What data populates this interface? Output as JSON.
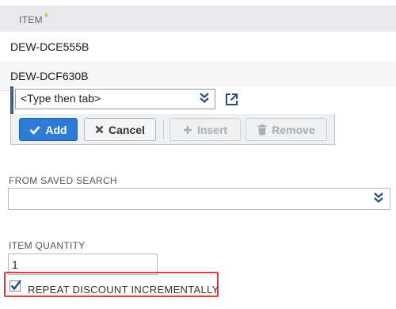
{
  "grid": {
    "header": {
      "label": "ITEM",
      "required_mark": "*"
    },
    "rows": [
      {
        "item": "DEW-DCE555B"
      },
      {
        "item": "DEW-DCF630B"
      }
    ],
    "edit_row": {
      "placeholder_value": "<Type then tab>"
    }
  },
  "buttons": {
    "add": "Add",
    "cancel": "Cancel",
    "insert": "Insert",
    "remove": "Remove"
  },
  "saved_search": {
    "label": "FROM SAVED SEARCH",
    "value": ""
  },
  "item_quantity": {
    "label": "ITEM QUANTITY",
    "value": "1"
  },
  "repeat_discount": {
    "label": "REPEAT DISCOUNT INCREMENTALLY",
    "checked": true
  },
  "colors": {
    "accent_blue": "#2f7cd8",
    "highlight_red": "#e23b3b",
    "required_orange": "#e49d1c",
    "edit_row_bar": "#3f5d86"
  },
  "icons": {
    "dropdown": "double-chevron-down-icon",
    "popout": "popout-icon",
    "add": "checkmark-icon",
    "cancel": "x-icon",
    "insert": "plus-icon",
    "remove": "trash-icon",
    "checkbox": "checkmark-icon"
  }
}
